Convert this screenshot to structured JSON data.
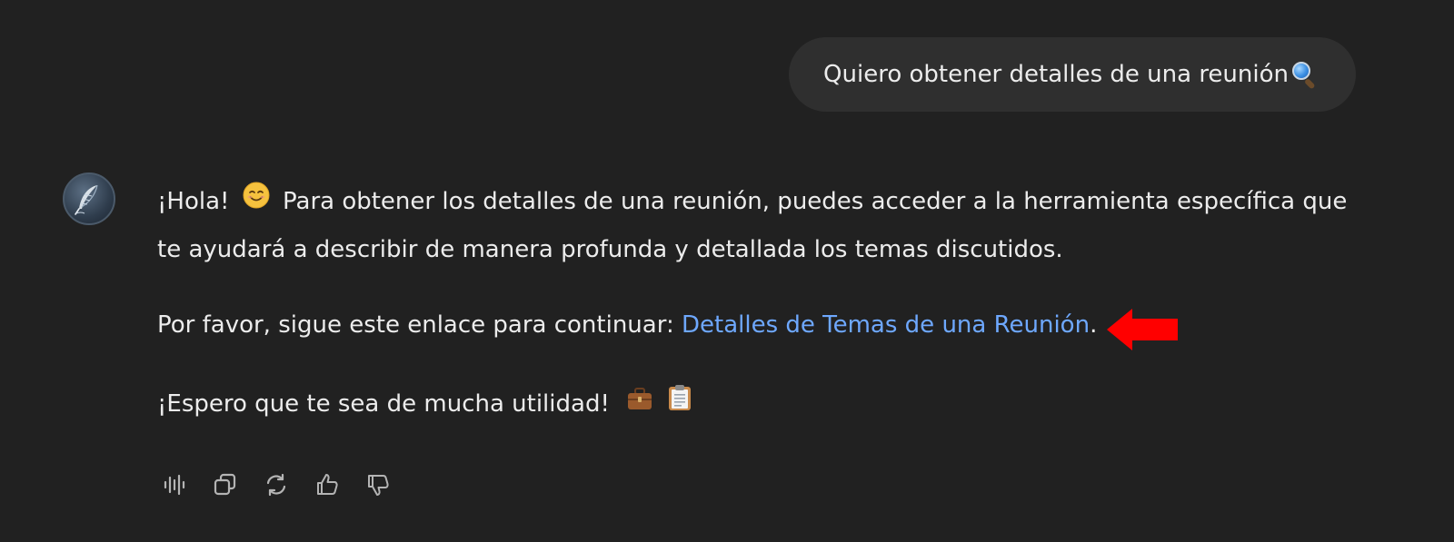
{
  "user_message": {
    "text": "Quiero obtener detalles de una reunión",
    "trailing_icon": "magnifying-glass-emoji"
  },
  "assistant_message": {
    "para1_greeting": "¡Hola!",
    "para1_body": "Para obtener los detalles de una reunión, puedes acceder a la herramienta específica que te ayudará a describir de manera profunda y detallada los temas discutidos.",
    "para2_prefix": "Por favor, sigue este enlace para continuar:",
    "para2_link": "Detalles de Temas de una Reunión",
    "para2_suffix": ".",
    "para3_text": "¡Espero que te sea de mucha utilidad!",
    "emojis": [
      "smiling-face-emoji",
      "briefcase-emoji",
      "clipboard-emoji"
    ]
  },
  "actions": [
    {
      "name": "read-aloud-icon"
    },
    {
      "name": "copy-icon"
    },
    {
      "name": "regenerate-icon"
    },
    {
      "name": "thumbs-up-icon"
    },
    {
      "name": "thumbs-down-icon"
    }
  ],
  "colors": {
    "background": "#212121",
    "user_bubble": "#2f2f2f",
    "text": "#ececec",
    "link": "#6ea8fe",
    "annotation_arrow": "#ff0000",
    "icon": "#b4b4b4"
  }
}
